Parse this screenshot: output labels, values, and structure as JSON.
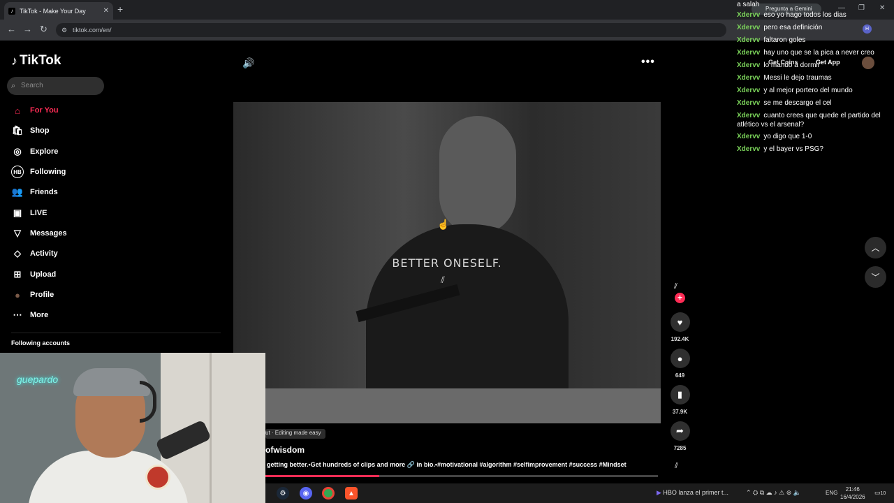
{
  "browser": {
    "tab_title": "TikTok - Make Your Day",
    "tab_close": "✕",
    "new_tab": "+",
    "url": "tiktok.com/en/",
    "back": "←",
    "forward": "→",
    "reload": "↻",
    "minimize": "—",
    "restore": "❐",
    "close": "✕",
    "gemini_label": "Pregunta a Gemini",
    "profile_letter": "H"
  },
  "sidebar": {
    "logo_text": "TikTok",
    "search_placeholder": "Search",
    "items": [
      {
        "label": "For You",
        "icon": "⌂"
      },
      {
        "label": "Shop",
        "icon": "🛍"
      },
      {
        "label": "Explore",
        "icon": "◎"
      },
      {
        "label": "Following",
        "icon": "HB"
      },
      {
        "label": "Friends",
        "icon": "👥"
      },
      {
        "label": "LIVE",
        "icon": "▣"
      },
      {
        "label": "Messages",
        "icon": "▽"
      },
      {
        "label": "Activity",
        "icon": "◇"
      },
      {
        "label": "Upload",
        "icon": "⊞"
      },
      {
        "label": "Profile",
        "icon": "●"
      },
      {
        "label": "More",
        "icon": "⋯"
      }
    ],
    "following_accounts": "Following accounts"
  },
  "webcam": {
    "neon_text": "guepardo"
  },
  "video": {
    "overlay_caption": "BETTER ONESELF.",
    "capcut_label": "ut · Editing made easy",
    "author": "ofwisdom",
    "description": "getting better.•Get hundreds of clips and more 🔗 in bio.•#motivational #algorithm #selfimprovement #success #Mindset",
    "progress": 0.29
  },
  "actions": {
    "likes": "192.4K",
    "comments": "649",
    "saves": "37.9K",
    "shares": "7285"
  },
  "topbar": {
    "get_coins": "Get Coins",
    "get_app": "Get App"
  },
  "chat": [
    {
      "user": "",
      "text": "a salah"
    },
    {
      "user": "Xdervv",
      "text": "eso yo hago todos los dias"
    },
    {
      "user": "Xdervv",
      "text": "pero esa definición"
    },
    {
      "user": "Xdervv",
      "text": "faltaron goles"
    },
    {
      "user": "Xdervv",
      "text": "hay uno que se la pica a never creo"
    },
    {
      "user": "Xdervv",
      "text": "lo mando a dormir"
    },
    {
      "user": "Xdervv",
      "text": "Messi le dejo traumas"
    },
    {
      "user": "Xdervv",
      "text": "y al mejor portero del mundo"
    },
    {
      "user": "Xdervv",
      "text": "se me descargo el cel"
    },
    {
      "user": "Xdervv",
      "text": "cuanto crees que quede el partido del atlético vs el arsenal?"
    },
    {
      "user": "Xdervv",
      "text": "yo digo que 1-0"
    },
    {
      "user": "Xdervv",
      "text": "y el bayer vs PSG?"
    }
  ],
  "taskbar": {
    "news": "HBO lanza el primer t...",
    "lang": "ENG",
    "time": "21:46",
    "date": "16/4/2026",
    "notifications": "10"
  }
}
